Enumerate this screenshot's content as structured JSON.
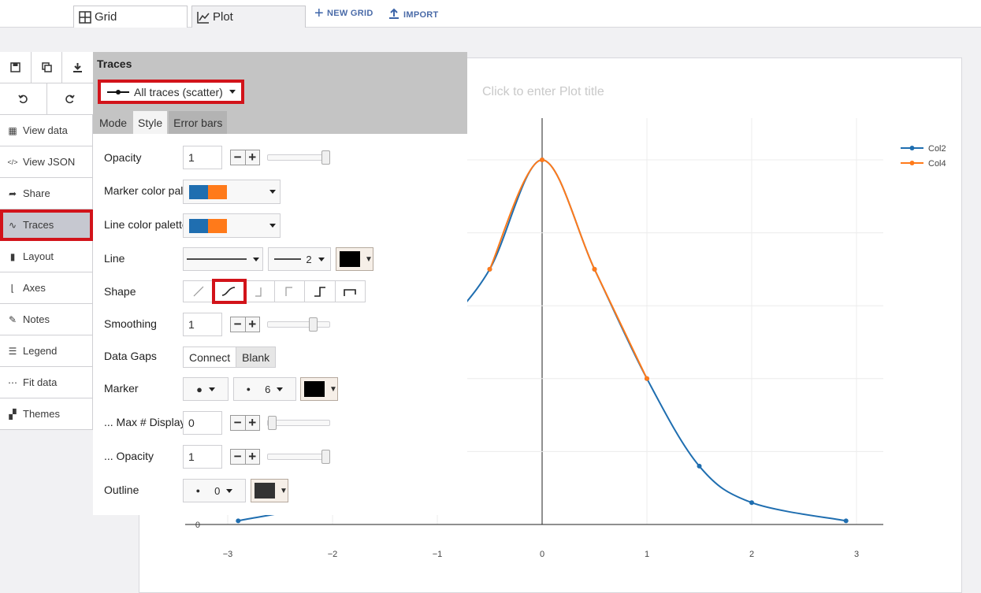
{
  "topbar": {
    "tabs": [
      {
        "label": "Grid"
      },
      {
        "label": "Plot"
      }
    ],
    "new_grid_label": "NEW GRID",
    "import_label": "IMPORT"
  },
  "sidebar": {
    "icon_buttons": [
      "save-icon",
      "copy-icon",
      "download-icon",
      "undo-icon",
      "redo-icon"
    ],
    "items": [
      {
        "label": "View data",
        "icon": "grid-icon"
      },
      {
        "label": "View JSON",
        "icon": "code-icon"
      },
      {
        "label": "Share",
        "icon": "share-icon"
      },
      {
        "label": "Traces",
        "icon": "trace-icon",
        "active": true
      },
      {
        "label": "Layout",
        "icon": "page-icon"
      },
      {
        "label": "Axes",
        "icon": "axes-icon"
      },
      {
        "label": "Notes",
        "icon": "pencil-icon"
      },
      {
        "label": "Legend",
        "icon": "list-icon"
      },
      {
        "label": "Fit data",
        "icon": "fit-icon"
      },
      {
        "label": "Themes",
        "icon": "paint-roller-icon"
      }
    ]
  },
  "panel": {
    "title": "Traces",
    "trace_selector": "All traces (scatter)",
    "tabs": [
      "Mode",
      "Style",
      "Error bars"
    ],
    "active_tab": "Style",
    "rows": {
      "opacity": {
        "label": "Opacity",
        "value": "1",
        "level": 1.0
      },
      "marker_palette": {
        "label": "Marker color palette",
        "colors": [
          "#1f6eb0",
          "#ff7a1a"
        ]
      },
      "line_palette": {
        "label": "Line color palette",
        "colors": [
          "#1f6eb0",
          "#ff7a1a"
        ]
      },
      "line": {
        "label": "Line",
        "width": "2",
        "color": "#000000"
      },
      "shape": {
        "label": "Shape",
        "options": [
          "linear-shape-icon",
          "spline-shape-icon",
          "hv-shape-icon",
          "vh-shape-icon",
          "hvh-shape-icon",
          "vhv-shape-icon"
        ],
        "selected_index": 1
      },
      "smoothing": {
        "label": "Smoothing",
        "value": "1",
        "level": 0.77
      },
      "data_gaps": {
        "label": "Data Gaps",
        "options": [
          "Connect",
          "Blank"
        ]
      },
      "marker": {
        "label": "Marker",
        "size": "6",
        "color": "#000000"
      },
      "max_displayed": {
        "label": "... Max # Displayed",
        "value": "0",
        "level": 0.0
      },
      "marker_opacity": {
        "label": "... Opacity",
        "value": "1",
        "level": 1.0
      },
      "outline": {
        "label": "Outline",
        "width": "0",
        "color": "#333333"
      }
    }
  },
  "plot": {
    "title_placeholder": "Click to enter Plot title"
  },
  "chart_data": {
    "type": "line",
    "xticks": [
      "−3",
      "−2",
      "−1",
      "0",
      "1",
      "2",
      "3"
    ],
    "yticks_visible": [
      "0"
    ],
    "xlim": [
      -3.3,
      3.3
    ],
    "ylim": [
      0,
      1.05
    ],
    "legend_position": "top-right",
    "series": [
      {
        "name": "Col2",
        "color": "#1f6eb0",
        "x": [
          -2.9,
          -2,
          -1.5,
          -1,
          -0.5,
          0,
          0.5,
          1,
          1.5,
          2,
          2.9
        ],
        "y": [
          0.01,
          0.07,
          0.2,
          0.5,
          0.7,
          1.0,
          0.7,
          0.4,
          0.16,
          0.06,
          0.01
        ]
      },
      {
        "name": "Col4",
        "color": "#ff7a1a",
        "x": [
          -0.5,
          0,
          0.5,
          1
        ],
        "y": [
          0.7,
          1.0,
          0.7,
          0.4
        ]
      }
    ]
  }
}
